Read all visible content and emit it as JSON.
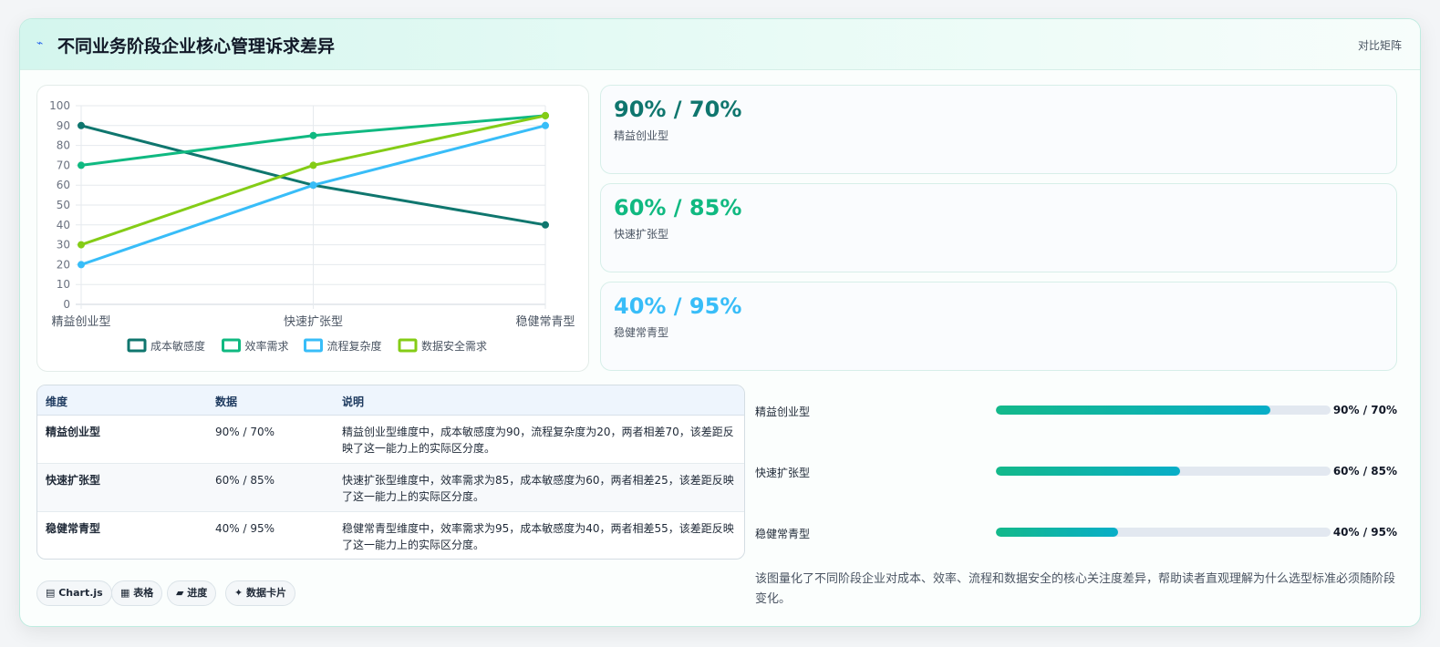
{
  "header": {
    "title": "不同业务阶段企业核心管理诉求差异",
    "tag": "对比矩阵",
    "icon": "bolt-icon"
  },
  "chart_data": {
    "type": "line",
    "categories": [
      "精益创业型",
      "快速扩张型",
      "稳健常青型"
    ],
    "ylim": [
      0,
      100
    ],
    "yticks": [
      "0",
      "10",
      "20",
      "30",
      "40",
      "50",
      "60",
      "70",
      "80",
      "90",
      "100"
    ],
    "grid": true,
    "legend_position": "bottom",
    "series": [
      {
        "name": "成本敏感度",
        "values": [
          90,
          60,
          40
        ],
        "color": "#0f766e"
      },
      {
        "name": "效率需求",
        "values": [
          70,
          85,
          95
        ],
        "color": "#10b981"
      },
      {
        "name": "流程复杂度",
        "values": [
          20,
          60,
          90
        ],
        "color": "#38bdf8"
      },
      {
        "name": "数据安全需求",
        "values": [
          30,
          70,
          95
        ],
        "color": "#84cc16"
      }
    ]
  },
  "stats": [
    {
      "value": "90% / 70%",
      "label": "精益创业型",
      "color": "#0f766e"
    },
    {
      "value": "60% / 85%",
      "label": "快速扩张型",
      "color": "#10b981"
    },
    {
      "value": "40% / 95%",
      "label": "稳健常青型",
      "color": "#38bdf8"
    }
  ],
  "table": {
    "headers": [
      "维度",
      "数据",
      "说明"
    ],
    "rows": [
      [
        "精益创业型",
        "90% / 70%",
        "精益创业型维度中，成本敏感度为90，流程复杂度为20，两者相差70，该差距反映了这一能力上的实际区分度。"
      ],
      [
        "快速扩张型",
        "60% / 85%",
        "快速扩张型维度中，效率需求为85，成本敏感度为60，两者相差25，该差距反映了这一能力上的实际区分度。"
      ],
      [
        "稳健常青型",
        "40% / 95%",
        "稳健常青型维度中，效率需求为95，成本敏感度为40，两者相差55，该差距反映了这一能力上的实际区分度。"
      ]
    ]
  },
  "chips": [
    {
      "label": "▤ Chart.js"
    },
    {
      "label": "▦ 表格"
    },
    {
      "label": "▰ 进度"
    },
    {
      "label": "✦ 数据卡片"
    }
  ],
  "progress": [
    {
      "label": "精益创业型",
      "value": "90% / 70%",
      "fill": 0.82
    },
    {
      "label": "快速扩张型",
      "value": "60% / 85%",
      "fill": 0.55
    },
    {
      "label": "稳健常青型",
      "value": "40% / 95%",
      "fill": 0.365
    }
  ],
  "summary": "该图量化了不同阶段企业对成本、效率、流程和数据安全的核心关注度差异，帮助读者直观理解为什么选型标准必须随阶段变化。"
}
